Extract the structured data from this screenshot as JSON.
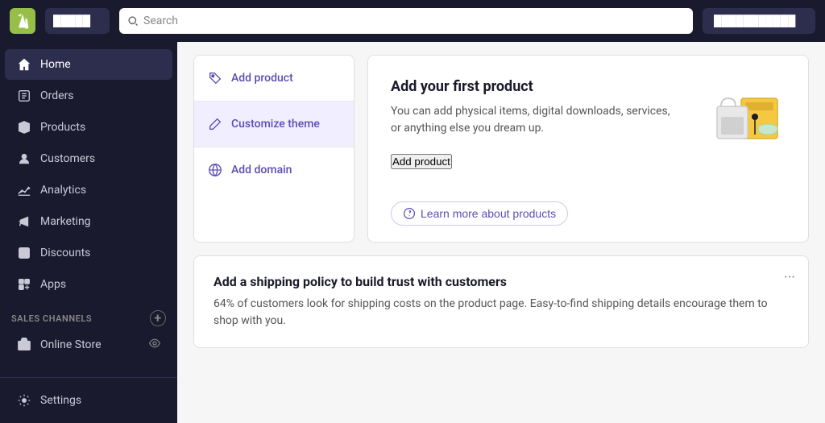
{
  "topbar": {
    "store_name": "█████",
    "search_placeholder": "Search",
    "right_button": "███████████"
  },
  "sidebar": {
    "items": [
      {
        "id": "home",
        "label": "Home",
        "active": true
      },
      {
        "id": "orders",
        "label": "Orders"
      },
      {
        "id": "products",
        "label": "Products"
      },
      {
        "id": "customers",
        "label": "Customers"
      },
      {
        "id": "analytics",
        "label": "Analytics"
      },
      {
        "id": "marketing",
        "label": "Marketing"
      },
      {
        "id": "discounts",
        "label": "Discounts"
      },
      {
        "id": "apps",
        "label": "Apps"
      }
    ],
    "sales_channels_label": "SALES CHANNELS",
    "online_store_label": "Online Store",
    "settings_label": "Settings"
  },
  "actions": [
    {
      "id": "add-product",
      "label": "Add product",
      "icon": "tag"
    },
    {
      "id": "customize-theme",
      "label": "Customize theme",
      "icon": "pen"
    },
    {
      "id": "add-domain",
      "label": "Add domain",
      "icon": "globe"
    }
  ],
  "feature": {
    "title": "Add your first product",
    "description": "You can add physical items, digital downloads, services, or anything else you dream up.",
    "cta_label": "Add product",
    "learn_more_label": "Learn more about products"
  },
  "shipping": {
    "title": "Add a shipping policy to build trust with customers",
    "description": "64% of customers look for shipping costs on the product page. Easy-to-find shipping details encourage them to shop with you."
  }
}
